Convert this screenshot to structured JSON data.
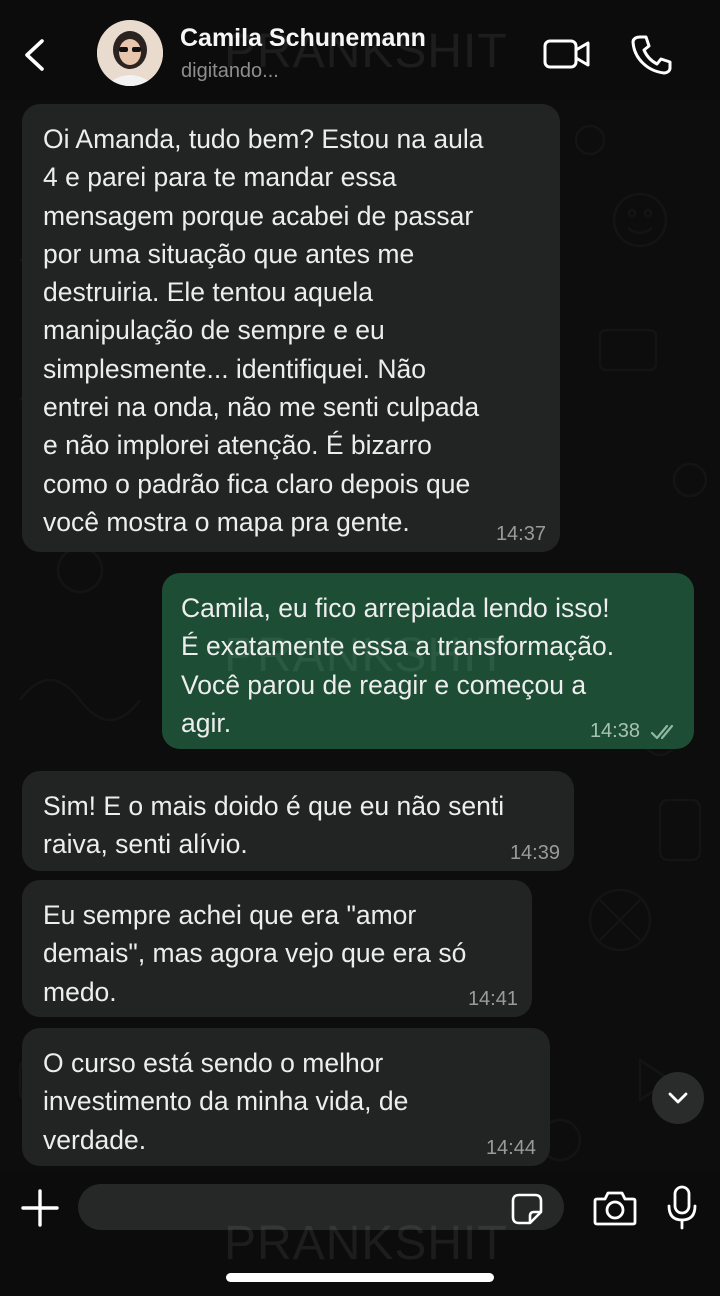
{
  "header": {
    "contact_name": "Camila Schunemann",
    "status": "digitando..."
  },
  "messages": [
    {
      "direction": "incoming",
      "text": "Oi Amanda, tudo bem? Estou na aula\n4 e parei para te mandar essa\nmensagem porque acabei de passar\npor uma situação que antes me\ndestruiria. Ele tentou aquela\nmanipulação de sempre e eu\nsimplesmente... identifiquei. Não\nentrei na onda, não me senti culpada\ne não implorei atenção. É bizarro\ncomo o padrão fica claro depois que\nvocê mostra o mapa pra gente.",
      "time": "14:37"
    },
    {
      "direction": "outgoing",
      "text": "Camila, eu fico arrepiada lendo isso!\nÉ exatamente essa a transformação.\nVocê parou de reagir e começou a\nagir.",
      "time": "14:38",
      "status": "read"
    },
    {
      "direction": "incoming",
      "text": "Sim! E o mais doido é que eu não senti\nraiva, senti alívio.",
      "time": "14:39"
    },
    {
      "direction": "incoming",
      "text": "Eu sempre achei que era \"amor\ndemais\", mas agora vejo que era só\nmedo.",
      "time": "14:41"
    },
    {
      "direction": "incoming",
      "text": "O curso está sendo o melhor\ninvestimento da minha vida, de\nverdade.",
      "time": "14:44"
    }
  ],
  "composer": {
    "placeholder": "",
    "value": ""
  },
  "watermark": "PRANKSHIT",
  "colors": {
    "background": "#0b0b0b",
    "incoming_bubble": "#222323",
    "outgoing_bubble": "#1d4d34",
    "read_ticks": "#8fb8a3"
  },
  "icons": [
    "back-arrow-icon",
    "avatar-photo",
    "video-camera-icon",
    "phone-icon",
    "chevron-down-icon",
    "plus-icon",
    "sticker-icon",
    "camera-icon",
    "microphone-icon",
    "double-check-icon"
  ]
}
